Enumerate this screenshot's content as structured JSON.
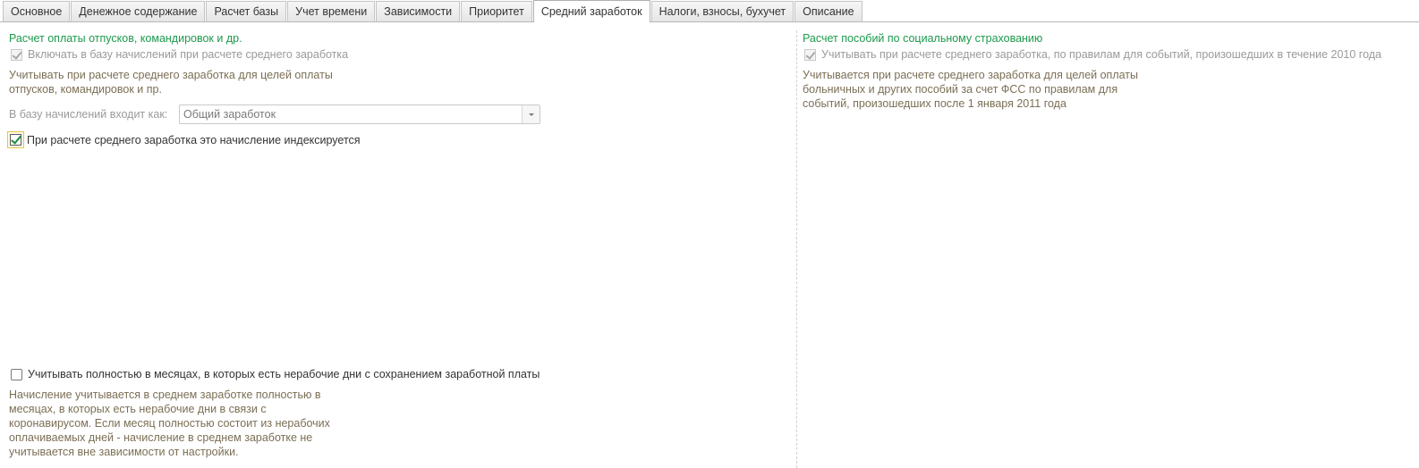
{
  "tabs": [
    {
      "label": "Основное"
    },
    {
      "label": "Денежное содержание"
    },
    {
      "label": "Расчет базы"
    },
    {
      "label": "Учет времени"
    },
    {
      "label": "Зависимости"
    },
    {
      "label": "Приоритет"
    },
    {
      "label": "Средний заработок",
      "active": true
    },
    {
      "label": "Налоги, взносы, бухучет"
    },
    {
      "label": "Описание"
    }
  ],
  "left": {
    "title": "Расчет оплаты отпусков, командировок и др.",
    "include_label": "Включать в базу начислений при расчете среднего заработка",
    "include_hint": [
      "Учитывать при расчете среднего заработка для целей оплаты",
      "отпусков, командировок и пр."
    ],
    "base_label": "В базу начислений входит как:",
    "base_value": "Общий заработок",
    "indexed_label": "При расчете среднего заработка это начисление индексируется",
    "full_months_label": "Учитывать полностью в месяцах, в которых есть нерабочие дни с сохранением заработной платы",
    "full_months_hint": [
      "Начисление учитывается в среднем заработке полностью в",
      "месяцах, в которых есть нерабочие дни в связи с",
      "коронавирусом. Если месяц полностью состоит из нерабочих",
      "оплачиваемых дней - начисление в среднем заработке не",
      "учитывается вне зависимости от настройки."
    ]
  },
  "right": {
    "title": "Расчет пособий по социальному страхованию",
    "include_label": "Учитывать при расчете среднего заработка, по правилам для событий, произошедших в течение 2010 года",
    "hint": [
      "Учитывается при расчете среднего заработка для целей оплаты",
      "больничных и других пособий за счет ФСС по правилам для",
      "событий, произошедших после 1 января 2011 года"
    ]
  }
}
